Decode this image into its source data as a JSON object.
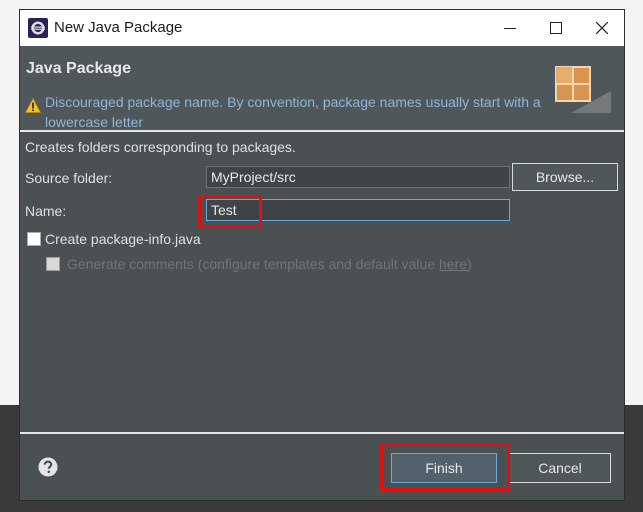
{
  "window": {
    "title": "New Java Package"
  },
  "banner": {
    "title": "Java Package",
    "message": "Discouraged package name. By convention, package names usually start with a lowercase letter"
  },
  "description": "Creates folders corresponding to packages.",
  "form": {
    "source_folder_label": "Source folder:",
    "source_folder_value": "MyProject/src",
    "browse_label": "Browse...",
    "name_label": "Name:",
    "name_value": "Test",
    "create_info_label": "Create package-info.java",
    "create_info_checked": false,
    "generate_comments_label": "Generate comments (configure templates and default value ",
    "generate_comments_link": "here",
    "generate_comments_suffix": ")",
    "generate_comments_checked": false
  },
  "footer": {
    "finish_label": "Finish",
    "cancel_label": "Cancel"
  },
  "icons": {
    "app": "eclipse-icon",
    "warning": "warning-icon",
    "help": "help-icon",
    "banner": "package-wizard-icon"
  },
  "colors": {
    "dialog_bg": "#4b5053",
    "banner_bg": "#50575b",
    "message_text": "#8fb6d4",
    "focus_border": "#6fa8dc",
    "highlight": "#e01010"
  }
}
